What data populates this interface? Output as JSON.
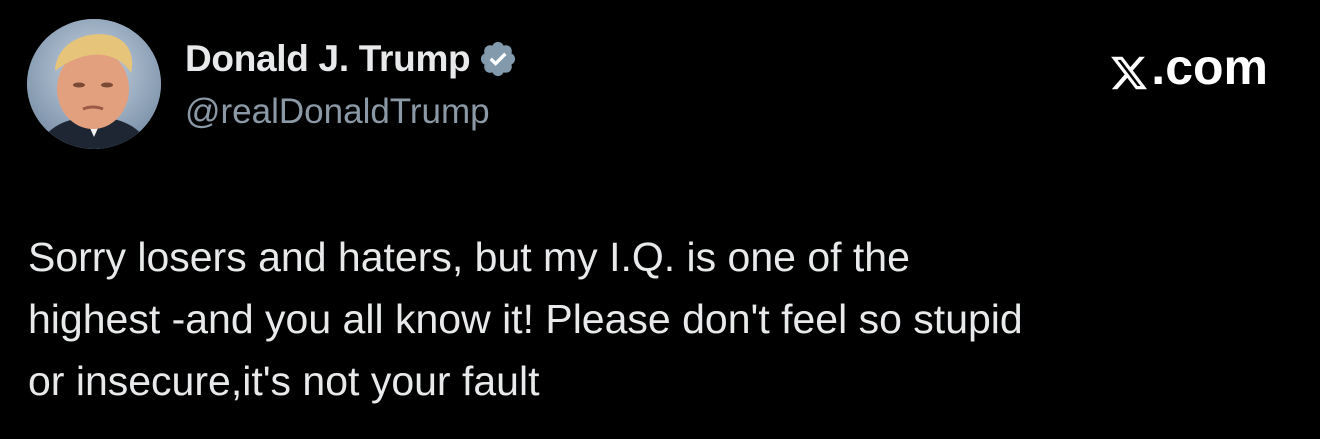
{
  "author": {
    "display_name": "Donald J. Trump",
    "handle": "@realDonaldTrump",
    "verified": true
  },
  "brand": {
    "icon": "x-logo-icon",
    "suffix": ".com"
  },
  "tweet": {
    "text": "Sorry losers and haters, but my I.Q. is one of the\nhighest -and you all know it! Please don't feel so stupid\nor insecure,it's not your fault"
  },
  "colors": {
    "background": "#000000",
    "text": "#e7e9ea",
    "handle": "#8b98a5",
    "verified_badge": "#829aab"
  }
}
